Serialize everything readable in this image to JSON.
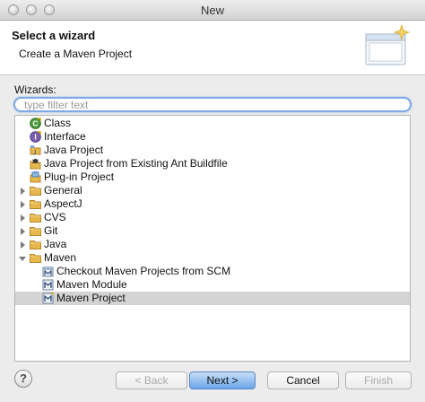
{
  "window": {
    "title": "New"
  },
  "header": {
    "title": "Select a wizard",
    "subtitle": "Create a Maven Project"
  },
  "wizards_label": "Wizards:",
  "filter": {
    "placeholder": "type filter text",
    "value": ""
  },
  "tree": {
    "items": [
      {
        "label": "Class",
        "icon": "class-icon",
        "level": 1,
        "expander": "none"
      },
      {
        "label": "Interface",
        "icon": "interface-icon",
        "level": 1,
        "expander": "none"
      },
      {
        "label": "Java Project",
        "icon": "java-project-icon",
        "level": 1,
        "expander": "none"
      },
      {
        "label": "Java Project from Existing Ant Buildfile",
        "icon": "ant-project-icon",
        "level": 1,
        "expander": "none"
      },
      {
        "label": "Plug-in Project",
        "icon": "plugin-project-icon",
        "level": 1,
        "expander": "none"
      },
      {
        "label": "General",
        "icon": "folder-icon",
        "level": 1,
        "expander": "collapsed"
      },
      {
        "label": "AspectJ",
        "icon": "folder-icon",
        "level": 1,
        "expander": "collapsed"
      },
      {
        "label": "CVS",
        "icon": "folder-icon",
        "level": 1,
        "expander": "collapsed"
      },
      {
        "label": "Git",
        "icon": "folder-icon",
        "level": 1,
        "expander": "collapsed"
      },
      {
        "label": "Java",
        "icon": "folder-icon",
        "level": 1,
        "expander": "collapsed"
      },
      {
        "label": "Maven",
        "icon": "folder-icon",
        "level": 1,
        "expander": "expanded"
      },
      {
        "label": "Checkout Maven Projects from SCM",
        "icon": "maven-checkout-icon",
        "level": 2,
        "expander": "none"
      },
      {
        "label": "Maven Module",
        "icon": "maven-module-icon",
        "level": 2,
        "expander": "none"
      },
      {
        "label": "Maven Project",
        "icon": "maven-project-icon",
        "level": 2,
        "expander": "none",
        "selected": true
      }
    ]
  },
  "buttons": {
    "help": "?",
    "back": "< Back",
    "next": "Next >",
    "cancel": "Cancel",
    "finish": "Finish"
  },
  "colors": {
    "selection": "#d4d4d4",
    "default_button": "#6aa5ea",
    "folder": "#e7b84b",
    "focus_ring": "#7fa9e3"
  }
}
